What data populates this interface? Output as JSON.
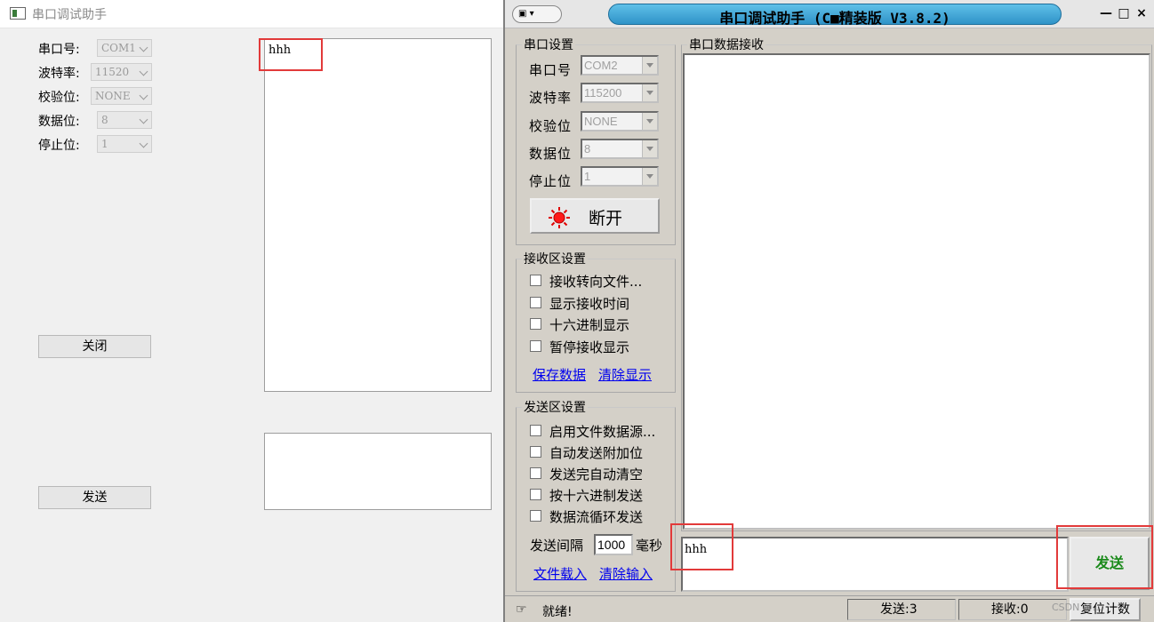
{
  "left_window": {
    "title": "串口调试助手",
    "labels": {
      "port": "串口号:",
      "baud": "波特率:",
      "parity": "校验位:",
      "databits": "数据位:",
      "stopbits": "停止位:"
    },
    "values": {
      "port": "COM1",
      "baud": "11520",
      "parity": "NONE",
      "databits": "8",
      "stopbits": "1"
    },
    "close_button": "关闭",
    "send_button": "发送",
    "receive_text": "hhh",
    "send_text": ""
  },
  "right_window": {
    "title": "串口调试助手 (C■精装版 V3.8.2)",
    "window_controls": {
      "min": "—",
      "max": "□",
      "close": "×"
    },
    "serial_group": {
      "legend": "串口设置",
      "labels": {
        "port": "串口号",
        "baud": "波特率",
        "parity": "校验位",
        "databits": "数据位",
        "stopbits": "停止位"
      },
      "values": {
        "port": "COM2",
        "baud": "115200",
        "parity": "NONE",
        "databits": "8",
        "stopbits": "1"
      },
      "disconnect_button": "断开"
    },
    "receive_group": {
      "legend": "接收区设置",
      "checkboxes": [
        "接收转向文件...",
        "显示接收时间",
        "十六进制显示",
        "暂停接收显示"
      ],
      "links": {
        "save": "保存数据",
        "clear": "清除显示"
      }
    },
    "send_group": {
      "legend": "发送区设置",
      "checkboxes": [
        "启用文件数据源...",
        "自动发送附加位",
        "发送完自动清空",
        "按十六进制发送",
        "数据流循环发送"
      ],
      "interval_label": "发送间隔",
      "interval_value": "1000",
      "interval_unit": "毫秒",
      "links": {
        "load": "文件载入",
        "clear": "清除输入"
      }
    },
    "receive_area": {
      "legend": "串口数据接收",
      "text": ""
    },
    "send_area_text": "hhh",
    "send_button": "发送",
    "status": {
      "ready": "就绪!",
      "sent": "发送:3",
      "received": "接收:0",
      "reset": "复位计数"
    },
    "watermark": "CSDN @..."
  },
  "colors": {
    "highlight": "#e23a3a",
    "send_button_text": "#1a8a1a",
    "title_pill": "#3aa6d8",
    "link": "#0000ee"
  }
}
